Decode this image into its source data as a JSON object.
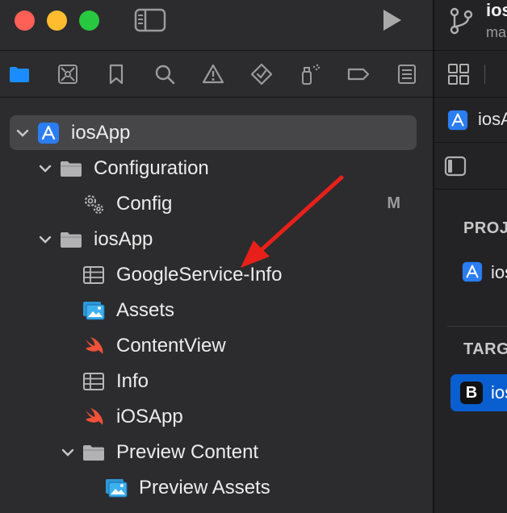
{
  "navigator": {
    "tree": [
      {
        "label": "iosApp",
        "icon": "xcode-project-icon",
        "chevron": "down",
        "selected": true,
        "badge": ""
      },
      {
        "label": "Configuration",
        "icon": "folder-icon",
        "chevron": "down",
        "badge": ""
      },
      {
        "label": "Config",
        "icon": "config-gears-icon",
        "chevron": "",
        "badge": "M"
      },
      {
        "label": "iosApp",
        "icon": "folder-icon",
        "chevron": "down",
        "badge": ""
      },
      {
        "label": "GoogleService-Info",
        "icon": "plist-icon",
        "chevron": "",
        "badge": ""
      },
      {
        "label": "Assets",
        "icon": "asset-catalog-icon",
        "chevron": "",
        "badge": ""
      },
      {
        "label": "ContentView",
        "icon": "swift-file-icon",
        "chevron": "",
        "badge": ""
      },
      {
        "label": "Info",
        "icon": "plist-icon",
        "chevron": "",
        "badge": ""
      },
      {
        "label": "iOSApp",
        "icon": "swift-file-icon",
        "chevron": "",
        "badge": ""
      },
      {
        "label": "Preview Content",
        "icon": "folder-icon",
        "chevron": "down",
        "badge": ""
      },
      {
        "label": "Preview Assets",
        "icon": "asset-catalog-icon",
        "chevron": "",
        "badge": ""
      }
    ]
  },
  "editor": {
    "title": "ios",
    "subtitle": "ma",
    "tab_label": "iosA",
    "project_header": "PROJ",
    "project_label": "ios",
    "targets_header": "TARG",
    "target_icon_letter": "B",
    "target_label": "ios"
  },
  "colors": {
    "accent": "#0a5fd0",
    "folder_blue": "#1a8cff",
    "arrow_red": "#e8201a",
    "swift_orange": "#f05138"
  }
}
